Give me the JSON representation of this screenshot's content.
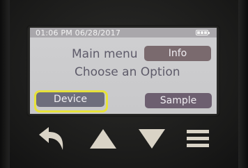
{
  "status_bar": {
    "datetime": "01:06 PM 06/28/2017",
    "battery_icon": "battery-full-icon"
  },
  "screen": {
    "line1": "Main menu",
    "line2": "Choose an Option"
  },
  "soft_buttons": {
    "info_label": "Info",
    "device_label": "Device",
    "sample_label": "Sample",
    "selected": "Device"
  },
  "hardware_keys": [
    {
      "name": "back",
      "icon": "back-arrow-icon"
    },
    {
      "name": "up",
      "icon": "triangle-up-icon"
    },
    {
      "name": "down",
      "icon": "triangle-down-icon"
    },
    {
      "name": "menu",
      "icon": "hamburger-menu-icon"
    }
  ],
  "colors": {
    "focus_ring": "#e7e23a",
    "screen_bg": "#cfcfd1",
    "key_fill": "#d9d3c6"
  }
}
